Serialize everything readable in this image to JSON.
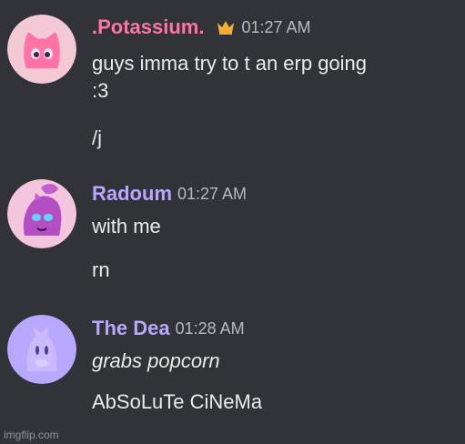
{
  "messages": [
    {
      "username": ".Potassium.",
      "timestamp": "01:27 AM",
      "user_color": "#ff73a6",
      "has_crown": true,
      "lines": [
        "guys imma try to t an erp going\n:3",
        "/j"
      ]
    },
    {
      "username": "Radoum",
      "timestamp": "01:27 AM",
      "user_color": "#b9a7ff",
      "lines": [
        "with me",
        "rn"
      ]
    },
    {
      "username": "The Dea",
      "timestamp": "01:28 AM",
      "user_color": "#b9a7ff",
      "lines": [
        "grabs popcorn",
        "AbSoLuTe CiNeMa"
      ]
    }
  ],
  "watermark": "imgflip.com",
  "icons": {
    "crown": "crown-icon"
  },
  "colors": {
    "background": "#313338",
    "text": "#e8eaed",
    "timestamp": "#b5bac1",
    "crown": "#f0b132"
  }
}
